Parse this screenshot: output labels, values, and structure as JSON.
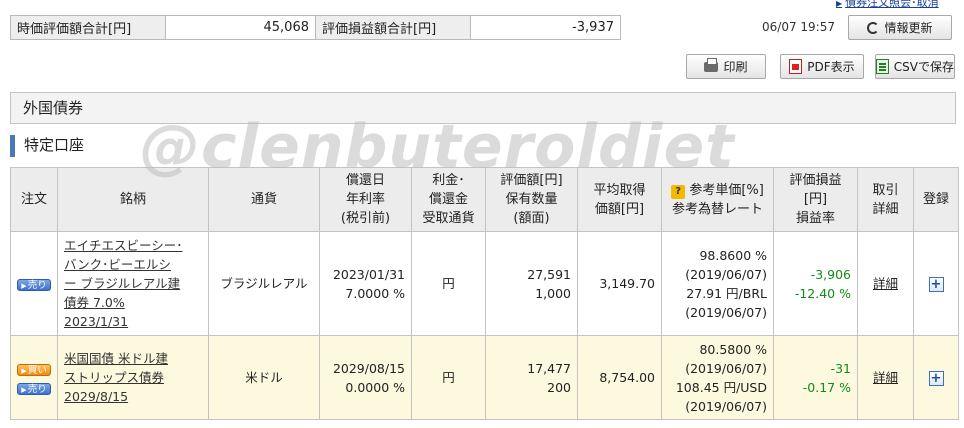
{
  "top_link": "債券注文照会･取消",
  "summary": {
    "market_value_label": "時価評価額合計[円]",
    "market_value": "45,068",
    "pl_label": "評価損益額合計[円]",
    "pl_value": "-3,937"
  },
  "timestamp": "06/07 19:57",
  "buttons": {
    "refresh": "情報更新",
    "print": "印刷",
    "pdf": "PDF表示",
    "csv": "CSVで保存"
  },
  "section_title": "外国債券",
  "account_title": "特定口座",
  "watermark": "@clenbuteroldiet",
  "table": {
    "headers": {
      "order": "注文",
      "issue": "銘柄",
      "currency": "通貨",
      "redemption": [
        "償還日",
        "年利率",
        "(税引前)"
      ],
      "interest": [
        "利金･",
        "償還金",
        "受取通貨"
      ],
      "valuation": [
        "評価額[円]",
        "保有数量",
        "(額面)"
      ],
      "avg_cost": [
        "平均取得",
        "価額[円]"
      ],
      "ref_price": [
        "参考単価[%]",
        "参考為替レート"
      ],
      "pl": [
        "評価損益",
        "[円]",
        "損益率"
      ],
      "trade": [
        "取引",
        "詳細"
      ],
      "register": "登録"
    },
    "rows": [
      {
        "buy_label": "",
        "sell_label": "売り",
        "name_lines": [
          "エイチエスビーシー･",
          "バンク･ビーエルシ",
          "ー ブラジルレアル建",
          "債券 7.0%"
        ],
        "name_date": "2023/1/31",
        "currency": "ブラジルレアル",
        "redemption_date": "2023/01/31",
        "rate": "7.0000 %",
        "receive_currency": "円",
        "valuation": "27,591",
        "quantity": "1,000",
        "avg_cost": "3,149.70",
        "ref_price": "98.8600 %",
        "ref_price_date": "(2019/06/07)",
        "fx_rate": "27.91 円/BRL",
        "fx_date": "(2019/06/07)",
        "pl": "-3,906",
        "pl_rate": "-12.40 %",
        "detail": "詳細"
      },
      {
        "buy_label": "買い",
        "sell_label": "売り",
        "name_lines": [
          "米国国債 米ドル建",
          "ストリップス債券"
        ],
        "name_date": "2029/8/15",
        "currency": "米ドル",
        "redemption_date": "2029/08/15",
        "rate": "0.0000 %",
        "receive_currency": "円",
        "valuation": "17,477",
        "quantity": "200",
        "avg_cost": "8,754.00",
        "ref_price": "80.5800 %",
        "ref_price_date": "(2019/06/07)",
        "fx_rate": "108.45 円/USD",
        "fx_date": "(2019/06/07)",
        "pl": "-31",
        "pl_rate": "-0.17 %",
        "detail": "詳細"
      }
    ]
  },
  "colors": {
    "accent_blue": "#4a78b8",
    "gain_loss_green": "#138a1a",
    "highlight_row": "#fdf9df",
    "header_bg": "#ececec"
  }
}
